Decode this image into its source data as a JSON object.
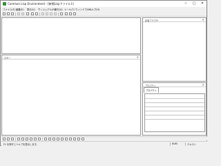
{
  "window": {
    "title": "Common Lisp Environment - [新規Lispファイル1]",
    "controls": {
      "minimize": "−",
      "maximize": "□",
      "close": "✕"
    }
  },
  "menu": [
    "ファイル(F)",
    "編集(E)",
    "表示(V)",
    "ヴィジュアル(R)",
    "実行(X)",
    "ツール(T)",
    "ウィンドウ(W)",
    "ヘルプ(H)"
  ],
  "panels": {
    "source": {
      "title": ""
    },
    "output": {
      "title": "ロガー"
    },
    "browser": {
      "title": "定義ブラウザ"
    },
    "properties": {
      "title": "プロパティ",
      "selection_label": "プロパティ"
    }
  },
  "status": {
    "message": "F1 を押すとヘルプを表示します。",
    "num": "NUM",
    "mode": "テキスト"
  }
}
